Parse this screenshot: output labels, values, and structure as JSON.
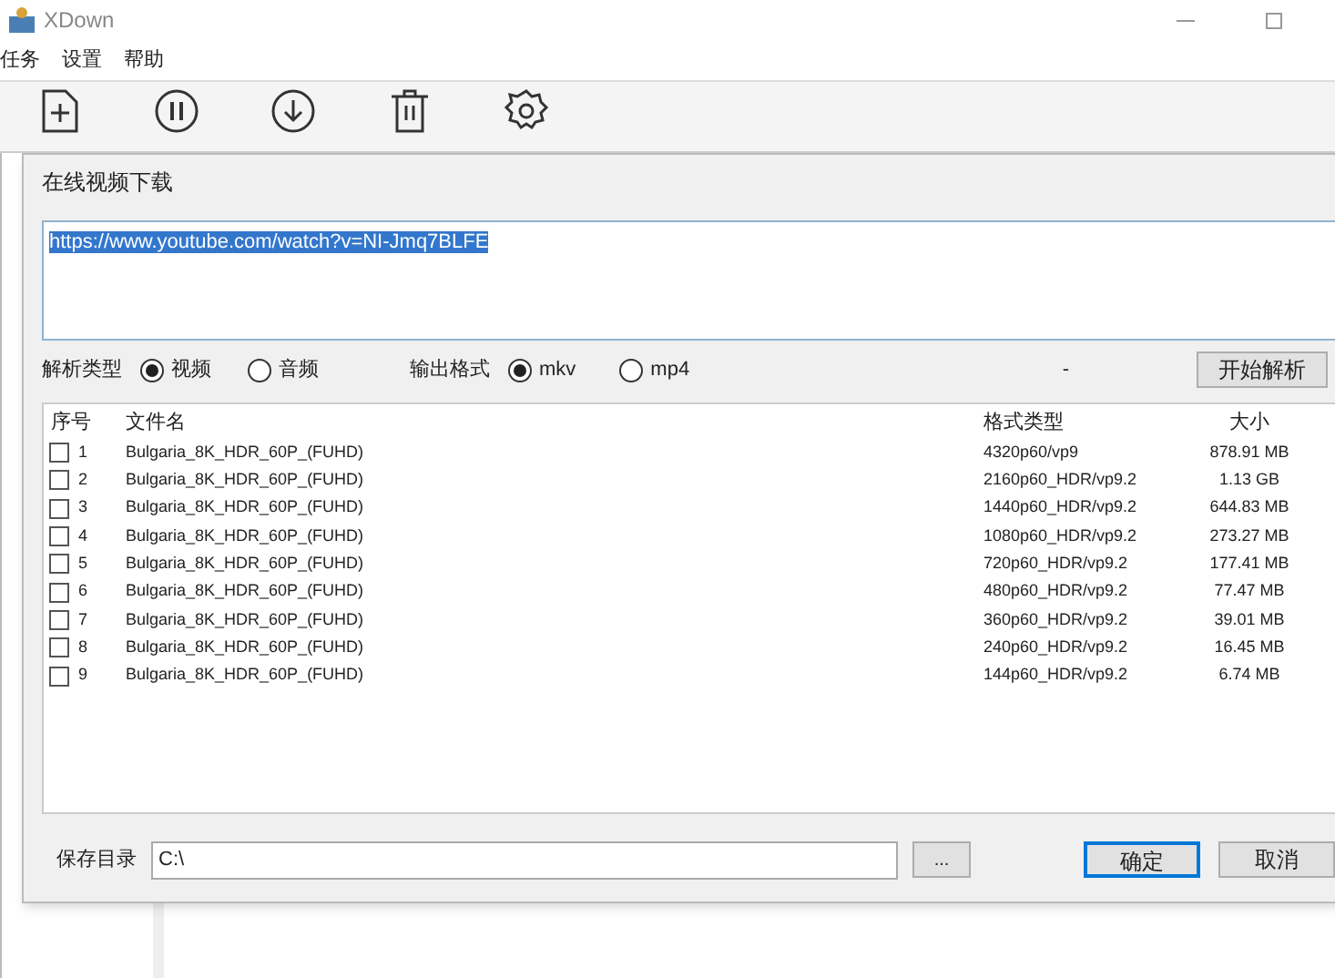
{
  "window": {
    "title": "XDown"
  },
  "menu": [
    "任务",
    "设置",
    "帮助"
  ],
  "dialog": {
    "title": "在线视频下载",
    "url_field": {
      "value": "https://www.youtube.com/watch?v=NI-Jmq7BLFE",
      "text_selected": true
    },
    "parse_type": {
      "label": "解析类型",
      "options": [
        {
          "label": "视频",
          "selected": true
        },
        {
          "label": "音频",
          "selected": false
        }
      ]
    },
    "output_format": {
      "label": "输出格式",
      "options": [
        {
          "label": "mkv",
          "selected": true
        },
        {
          "label": "mp4",
          "selected": false
        }
      ]
    },
    "status": "-",
    "parse_button": "开始解析",
    "table": {
      "columns": [
        "序号",
        "文件名",
        "格式类型",
        "大小"
      ],
      "rows": [
        {
          "index": "1",
          "name": "Bulgaria_8K_HDR_60P_(FUHD)",
          "format": "4320p60/vp9",
          "size": "878.91 MB",
          "checked": false
        },
        {
          "index": "2",
          "name": "Bulgaria_8K_HDR_60P_(FUHD)",
          "format": "2160p60_HDR/vp9.2",
          "size": "1.13 GB",
          "checked": false
        },
        {
          "index": "3",
          "name": "Bulgaria_8K_HDR_60P_(FUHD)",
          "format": "1440p60_HDR/vp9.2",
          "size": "644.83 MB",
          "checked": false
        },
        {
          "index": "4",
          "name": "Bulgaria_8K_HDR_60P_(FUHD)",
          "format": "1080p60_HDR/vp9.2",
          "size": "273.27 MB",
          "checked": false
        },
        {
          "index": "5",
          "name": "Bulgaria_8K_HDR_60P_(FUHD)",
          "format": "720p60_HDR/vp9.2",
          "size": "177.41 MB",
          "checked": false
        },
        {
          "index": "6",
          "name": "Bulgaria_8K_HDR_60P_(FUHD)",
          "format": "480p60_HDR/vp9.2",
          "size": "77.47 MB",
          "checked": false
        },
        {
          "index": "7",
          "name": "Bulgaria_8K_HDR_60P_(FUHD)",
          "format": "360p60_HDR/vp9.2",
          "size": "39.01 MB",
          "checked": false
        },
        {
          "index": "8",
          "name": "Bulgaria_8K_HDR_60P_(FUHD)",
          "format": "240p60_HDR/vp9.2",
          "size": "16.45 MB",
          "checked": false
        },
        {
          "index": "9",
          "name": "Bulgaria_8K_HDR_60P_(FUHD)",
          "format": "144p60_HDR/vp9.2",
          "size": "6.74 MB",
          "checked": false
        }
      ]
    },
    "save_dir": {
      "label": "保存目录",
      "value": "C:\\",
      "browse_button": "..."
    },
    "buttons": [
      {
        "label": "确定",
        "kind": "primary"
      },
      {
        "label": "取消",
        "kind": "normal"
      }
    ]
  }
}
